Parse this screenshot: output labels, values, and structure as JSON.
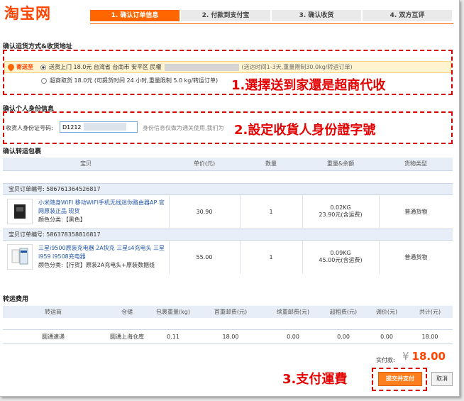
{
  "logo": "淘宝网",
  "steps": [
    "1. 确认订单信息",
    "2. 付款到支付宝",
    "3. 确认收货",
    "4. 双方互评"
  ],
  "shipping": {
    "section_title": "确认运货方式&收货地址",
    "send_to": "寄送至",
    "option1": "送货上门  18.0元   台湾省 台南市 安平区 民權",
    "option1_note": "(送达时间1-3天,重量限制30.0kg/转运订单)",
    "option2": "超商取货 18.0元 (可提货时间 24 小时,重量限制 5.0 kg/转运订单)"
  },
  "identity": {
    "section_title": "确认个人身份信息",
    "label": "收货人身份证号码:",
    "value": "D1212",
    "hint": "身份信息仅做为通关使用,我们为"
  },
  "annotations": {
    "a1": "1.選擇送到家還是超商代收",
    "a2": "2.設定收貨人身份證字號",
    "a3": "3.支付運費"
  },
  "items_section": {
    "title": "确认转运包裹",
    "headers": [
      "宝贝",
      "单价(元)",
      "数量",
      "重量&余额",
      "货物类型"
    ],
    "orders": [
      {
        "order_label": "宝贝订单编号: 586761364526817",
        "title": "小米随身WIFI 移动WIFI手机无线迷你路由器AP 官网原装正品 现货",
        "attr": "颜色分类:【黑色】",
        "price": "30.90",
        "qty": "1",
        "weight": "0.02KG",
        "balance": "23.90元(含运费)",
        "type": "普通货物"
      },
      {
        "order_label": "宝贝订单编号: 586378358816817",
        "title": "三星i9500原装充电器 2A快充 三星s4充电头 三星i959 i9508充电器",
        "attr": "颜色分类:【行货】原装2A充电头+原装数据线",
        "price": "55.00",
        "qty": "1",
        "weight": "0.09KG",
        "balance": "45.00元(含运费)",
        "type": "普通货物"
      }
    ]
  },
  "fee_section": {
    "title": "转运费用",
    "headers": [
      "转运商",
      "仓储",
      "包裹重量(kg)",
      "首重邮费(元)",
      "续重邮费(元)",
      "超租费(元)",
      "调价(元)",
      "共计(元)"
    ],
    "row": [
      "圆通速递",
      "圆通上海仓库",
      "0.11",
      "18.00",
      "0.00",
      "0.00",
      "0.00",
      "18.00"
    ]
  },
  "total": {
    "label": "实付款:",
    "currency": "¥",
    "amount": "18.00"
  },
  "buttons": {
    "submit": "提交并支付",
    "cancel": "取消"
  },
  "colors": {
    "brand": "#ff4400",
    "annotation": "#e40000"
  }
}
